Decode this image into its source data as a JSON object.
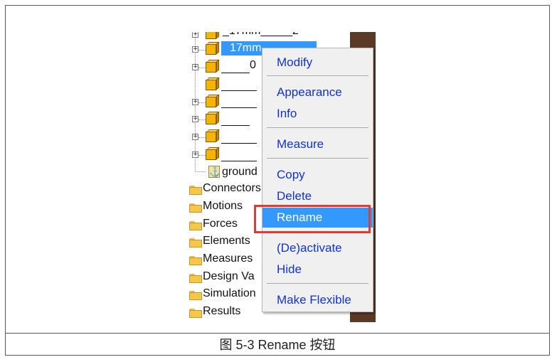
{
  "tree": {
    "partial_top_label": "_17mm_____2",
    "selected_label": "17mm",
    "item_label_0": "0",
    "ground_label": "ground",
    "folders": [
      "Connectors",
      "Motions",
      "Forces",
      "Elements",
      "Measures",
      "Design Va",
      "Simulation",
      "Results"
    ],
    "icons": {
      "part": "cube-part-icon",
      "folder": "folder-icon",
      "ground": "anchor-icon",
      "expander": "plus-expander-icon"
    }
  },
  "context_menu": {
    "items": [
      {
        "label": "Modify"
      },
      {
        "label": "Appearance"
      },
      {
        "label": "Info"
      },
      {
        "label": "Measure"
      },
      {
        "label": "Copy"
      },
      {
        "label": "Delete"
      },
      {
        "label": "Rename",
        "selected": true
      },
      {
        "label": "(De)activate"
      },
      {
        "label": "Hide"
      },
      {
        "label": "Make Flexible"
      }
    ]
  },
  "caption": "图 5-3 Rename 按钮",
  "colors": {
    "selection": "#3399ff",
    "menu_text": "#1133cc",
    "highlight_box": "#e53935",
    "menu_bg": "#f0f0f0"
  }
}
